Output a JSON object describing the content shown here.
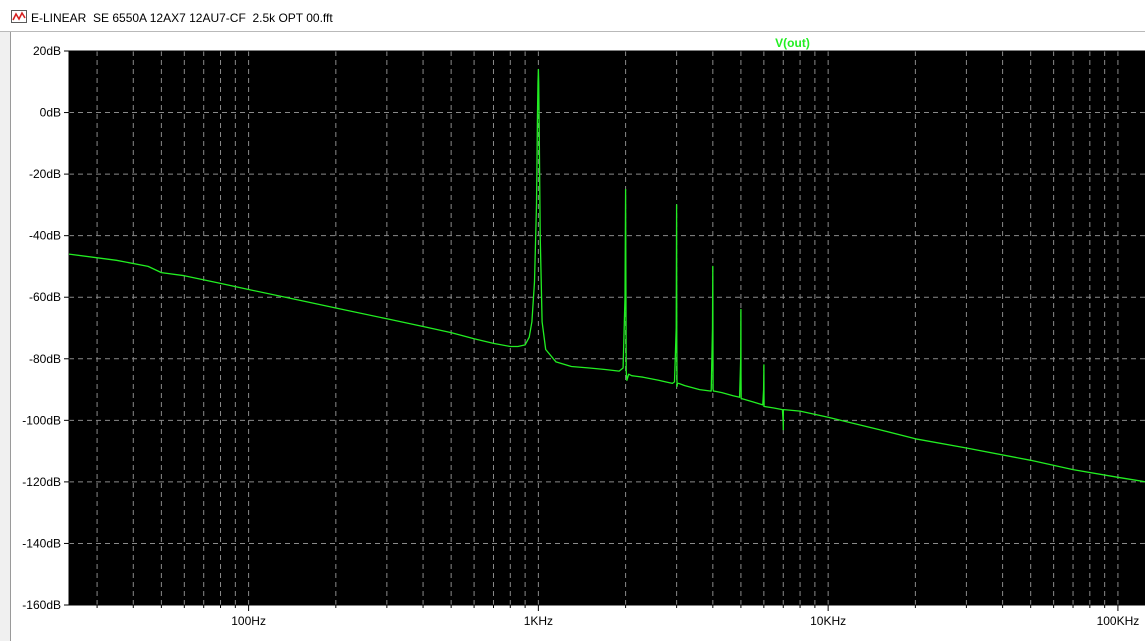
{
  "window": {
    "title": "E-LINEAR  SE 6550A 12AX7 12AU7-CF  2.5k OPT 00.fft",
    "icon": "waveform-icon"
  },
  "colors": {
    "plot_background": "#000000",
    "trace": "#22ee22",
    "grid": "#8a8a8a"
  },
  "chart_data": {
    "type": "line",
    "title": "",
    "xlabel": "",
    "ylabel": "",
    "xscale": "log",
    "xlim": [
      24,
      125000
    ],
    "ylim": [
      -160,
      20
    ],
    "grid": true,
    "legend": "top",
    "x_ticks": [
      {
        "value": 100,
        "label": "100Hz"
      },
      {
        "value": 1000,
        "label": "1KHz"
      },
      {
        "value": 10000,
        "label": "10KHz"
      },
      {
        "value": 100000,
        "label": "100KHz"
      }
    ],
    "y_ticks": [
      {
        "value": 20,
        "label": "20dB"
      },
      {
        "value": 0,
        "label": "0dB"
      },
      {
        "value": -20,
        "label": "-20dB"
      },
      {
        "value": -40,
        "label": "-40dB"
      },
      {
        "value": -60,
        "label": "-60dB"
      },
      {
        "value": -80,
        "label": "-80dB"
      },
      {
        "value": -100,
        "label": "-100dB"
      },
      {
        "value": -120,
        "label": "-120dB"
      },
      {
        "value": -140,
        "label": "-140dB"
      },
      {
        "value": -160,
        "label": "-160dB"
      }
    ],
    "series": [
      {
        "name": "V(out)",
        "x": [
          24,
          35,
          45,
          50,
          60,
          80,
          100,
          150,
          200,
          300,
          400,
          500,
          600,
          700,
          800,
          850,
          900,
          930,
          950,
          970,
          985,
          993,
          997,
          1000,
          1003,
          1007,
          1015,
          1030,
          1060,
          1150,
          1300,
          1500,
          1700,
          1900,
          1960,
          1990,
          2000,
          2005,
          2010,
          2020,
          2050,
          2100,
          2300,
          2600,
          2900,
          2950,
          2990,
          3000,
          3005,
          3010,
          3020,
          3050,
          3200,
          3600,
          3950,
          3990,
          4000,
          4005,
          4010,
          4020,
          4050,
          4300,
          4700,
          4950,
          4990,
          5000,
          5005,
          5010,
          5020,
          5050,
          5500,
          5950,
          5990,
          6000,
          6005,
          6010,
          6030,
          6500,
          6950,
          6990,
          7000,
          7005,
          7010,
          7030,
          8000,
          10000,
          15000,
          20000,
          30000,
          50000,
          70000,
          100000,
          125000
        ],
        "y": [
          -46,
          -48,
          -50,
          -52,
          -53,
          -55.5,
          -57.5,
          -61,
          -63.5,
          -67,
          -69.5,
          -71.5,
          -73.5,
          -75,
          -76,
          -76,
          -75.5,
          -73,
          -68,
          -55,
          -30,
          0,
          10,
          14,
          10,
          -5,
          -40,
          -68,
          -77,
          -81,
          -82.5,
          -83,
          -83.5,
          -84,
          -83,
          -60,
          -25,
          -55,
          -84,
          -87,
          -85,
          -85.5,
          -86,
          -87,
          -88,
          -87.5,
          -70,
          -30,
          -75,
          -89,
          -88,
          -88,
          -88.7,
          -90,
          -90.5,
          -70,
          -50,
          -80,
          -90,
          -90.5,
          -90.5,
          -91,
          -92,
          -92.5,
          -80,
          -64,
          -85,
          -93,
          -93,
          -93,
          -94,
          -95,
          -90,
          -82,
          -92,
          -95.5,
          -95.5,
          -96,
          -96.5,
          -100,
          -103,
          -98,
          -96.5,
          -96.5,
          -97,
          -99,
          -103,
          -106,
          -109,
          -113,
          -116,
          -118.5,
          -120
        ]
      }
    ]
  }
}
